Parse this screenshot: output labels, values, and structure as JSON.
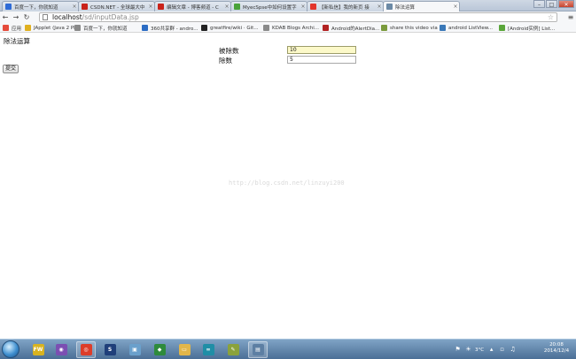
{
  "browser": {
    "tabs": [
      {
        "title": "百度一下，你就知道",
        "favicon": "baidu-paw-icon",
        "color": "#2e6bd6",
        "active": false
      },
      {
        "title": "CSDN.NET - 全球最大中",
        "favicon": "csdn-icon",
        "color": "#c9231b",
        "active": false
      },
      {
        "title": "编辑文章 - 博客频道 - C",
        "favicon": "csdn-icon",
        "color": "#c9231b",
        "active": false
      },
      {
        "title": "MyecSpse中如何设置字",
        "favicon": "myeclipse-icon",
        "color": "#4aa33b",
        "active": false
      },
      {
        "title": "【新私信】我的新页 接",
        "favicon": "weibo-icon",
        "color": "#e3352c",
        "active": false
      },
      {
        "title": "除法运算",
        "favicon": "page-icon",
        "color": "#6c8aa6",
        "active": true
      }
    ],
    "window_controls": {
      "minimize": "–",
      "maximize": "□",
      "close": "✕"
    },
    "url_host": "localhost",
    "url_path": "/sd/inputData.jsp",
    "bookmarks": [
      {
        "label": "应用",
        "icon": "apps-grid-icon",
        "color": "#e54b3c"
      },
      {
        "label": "JApplet (Java 2 Pl...",
        "icon": "bulb-icon",
        "color": "#e0b020"
      },
      {
        "label": "百度一下，你就知道",
        "icon": "page-icon",
        "color": "#8a8a8a"
      },
      {
        "label": "360共享群 - andro...",
        "icon": "badge-360-icon",
        "color": "#2b6cc4"
      },
      {
        "label": "greatfire/wiki · Git...",
        "icon": "github-icon",
        "color": "#222222"
      },
      {
        "label": "KDAB Blogs Archi...",
        "icon": "page-icon",
        "color": "#8a8a8a"
      },
      {
        "label": "Android的AlertDia...",
        "icon": "shield-icon",
        "color": "#b22222"
      },
      {
        "label": "share this video via",
        "icon": "android-icon",
        "color": "#7a9a3c"
      },
      {
        "label": "android ListView...",
        "icon": "android-icon",
        "color": "#3a78b8"
      },
      {
        "label": "[Android实例] List...",
        "icon": "android-icon",
        "color": "#5aa63a"
      }
    ]
  },
  "page": {
    "heading": "除法运算",
    "dividend_label": "被除数",
    "dividend_value": "10",
    "divisor_label": "除数",
    "divisor_value": "5",
    "submit_label": "提交",
    "watermark": "http://blog.csdn.net/linzuyi200"
  },
  "taskbar": {
    "apps": [
      {
        "icon": "fw-app-icon",
        "glyph": "FW",
        "color": "#d8b320",
        "active": false
      },
      {
        "icon": "purple-orb-icon",
        "glyph": "◉",
        "color": "#7b4fb2",
        "active": false
      },
      {
        "icon": "chrome-icon",
        "glyph": "◎",
        "color": "#dd3d2a",
        "active": true
      },
      {
        "icon": "eclipse-icon",
        "glyph": "S",
        "color": "#1f3f7a",
        "active": false
      },
      {
        "icon": "window-app-icon",
        "glyph": "▣",
        "color": "#6aa0cc",
        "active": false
      },
      {
        "icon": "green-app-icon",
        "glyph": "◆",
        "color": "#2e8b3c",
        "active": false
      },
      {
        "icon": "folder-icon",
        "glyph": "▭",
        "color": "#e1b64a",
        "active": false
      },
      {
        "icon": "arduino-icon",
        "glyph": "∞",
        "color": "#1f8ea6",
        "active": false
      },
      {
        "icon": "paint-icon",
        "glyph": "✎",
        "color": "#8aa23c",
        "active": false
      },
      {
        "icon": "monitor-icon",
        "glyph": "▤",
        "color": "#5d7fa3",
        "active": true
      }
    ],
    "tray": {
      "temperature": "3°C",
      "time": "20:08",
      "date": "2014/12/4"
    }
  }
}
